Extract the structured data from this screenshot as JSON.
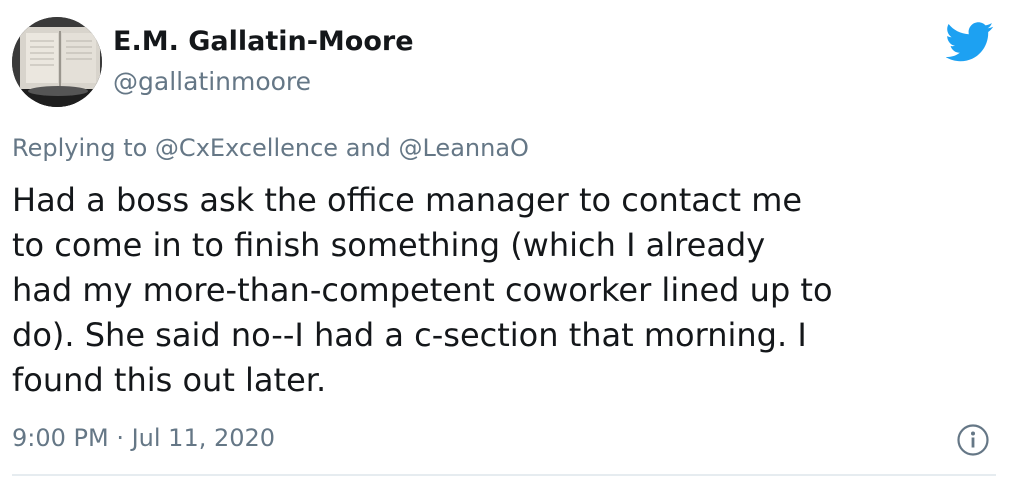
{
  "author": {
    "display_name": "E.M. Gallatin-Moore",
    "handle": "@gallatinmoore",
    "avatar_icon": "avatar-photo-book"
  },
  "brand_icon": "twitter-bird-icon",
  "brand_color": "#1da1f2",
  "reply_context": "Replying to @CxExcellence and @LeannaO",
  "tweet_lines": [
    "Had a boss ask the office manager to contact me",
    "to come in to finish something (which I already",
    "had my more-than-competent coworker lined up to",
    "do). She said no--I had a c-section that morning. I",
    "found this out later."
  ],
  "timestamp": "9:00 PM · Jul 11, 2020",
  "info_icon": "info-icon"
}
